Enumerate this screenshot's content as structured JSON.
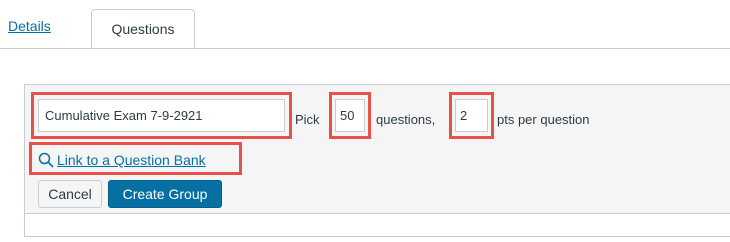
{
  "tabs": [
    {
      "label": "Details"
    },
    {
      "label": "Questions"
    }
  ],
  "group_form": {
    "name_value": "Cumulative Exam 7-9-2921",
    "pick_label": "Pick",
    "pick_value": "50",
    "questions_label": "questions,",
    "points_value": "2",
    "points_label": "pts per question",
    "link_label": "Link to a Question Bank",
    "cancel_label": "Cancel",
    "create_label": "Create Group"
  },
  "colors": {
    "link": "#0770a3",
    "primary_button": "#0770a3",
    "highlight": "#e8504a"
  },
  "icons": {
    "link_icon": "search-icon"
  }
}
